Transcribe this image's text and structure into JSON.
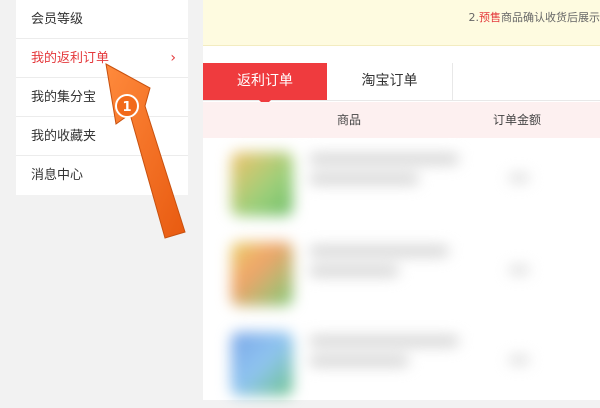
{
  "sidebar": {
    "items": [
      {
        "label": "会员等级",
        "active": false
      },
      {
        "label": "我的返利订单",
        "active": true
      },
      {
        "label": "我的集分宝",
        "active": false
      },
      {
        "label": "我的收藏夹",
        "active": false
      },
      {
        "label": "消息中心",
        "active": false
      }
    ],
    "chevron": "›"
  },
  "notice": {
    "prefix": "2.",
    "highlight": "预售",
    "rest": "商品确认收货后展示"
  },
  "tabs": [
    {
      "label": "返利订单",
      "active": true
    },
    {
      "label": "淘宝订单",
      "active": false
    }
  ],
  "table": {
    "columns": [
      "商品",
      "订单金额"
    ]
  },
  "annotation": {
    "step_number": "1"
  },
  "colors": {
    "accent": "#ef3b3e",
    "arrow": "#f26a1b",
    "notice_bg": "#fefbe0",
    "header_bg": "#fdf0f0"
  }
}
